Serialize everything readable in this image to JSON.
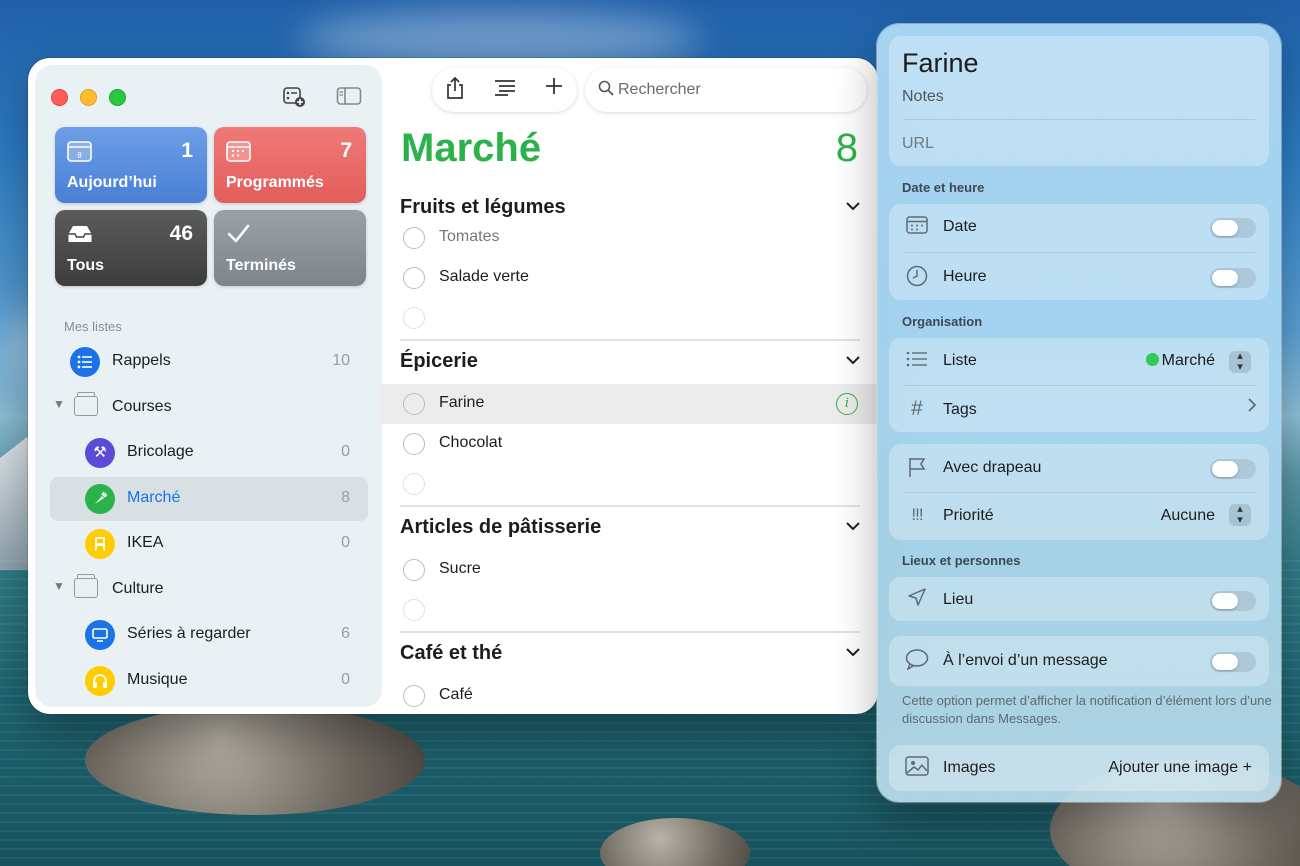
{
  "sidebar": {
    "tiles": {
      "today": {
        "label": "Aujourd’hui",
        "count": "1",
        "icon": "calendar-today-icon"
      },
      "scheduled": {
        "label": "Programmés",
        "count": "7",
        "icon": "calendar-icon"
      },
      "all": {
        "label": "Tous",
        "count": "46",
        "icon": "tray-icon"
      },
      "done": {
        "label": "Terminés",
        "count": "",
        "icon": "checkmark-icon"
      }
    },
    "section_label": "Mes listes",
    "lists": [
      {
        "label": "Rappels",
        "count": "10",
        "color": "#1a73e8"
      },
      {
        "label": "Courses"
      },
      {
        "label": "Bricolage",
        "count": "0",
        "color": "#5b4bd6"
      },
      {
        "label": "Marché",
        "count": "8",
        "color": "#2cb24b"
      },
      {
        "label": "IKEA",
        "count": "0",
        "color": "#ffcc00"
      },
      {
        "label": "Culture"
      },
      {
        "label": "Séries à regarder",
        "count": "6",
        "color": "#1a73e8"
      },
      {
        "label": "Musique",
        "count": "0",
        "color": "#ffcc00"
      }
    ],
    "today_day": "8"
  },
  "toolbar": {
    "search_placeholder": "Rechercher"
  },
  "list": {
    "title": "Marché",
    "count": "8",
    "accent": "#2cb24b",
    "groups": [
      {
        "name": "Fruits et légumes",
        "tasks": [
          "Tomates",
          "Salade verte"
        ]
      },
      {
        "name": "Épicerie",
        "tasks": [
          "Farine",
          "Chocolat"
        ]
      },
      {
        "name": "Articles de pâtisserie",
        "tasks": [
          "Sucre"
        ]
      },
      {
        "name": "Café et thé",
        "tasks": [
          "Café"
        ]
      }
    ]
  },
  "inspector": {
    "title": "Farine",
    "notes_placeholder": "Notes",
    "url_placeholder": "URL",
    "date_time_section": "Date et heure",
    "date_label": "Date",
    "time_label": "Heure",
    "organisation_section": "Organisation",
    "list_label": "Liste",
    "list_value": "Marché",
    "tags_label": "Tags",
    "flag_label": "Avec drapeau",
    "priority_label": "Priorité",
    "priority_value": "Aucune",
    "places_section": "Lieux et personnes",
    "location_label": "Lieu",
    "message_label": "À l’envoi d’un message",
    "message_note": "Cette option permet d’afficher la notification d’élément lors d’une discussion dans Messages.",
    "images_label": "Images",
    "add_image_label": "Ajouter une image +"
  }
}
